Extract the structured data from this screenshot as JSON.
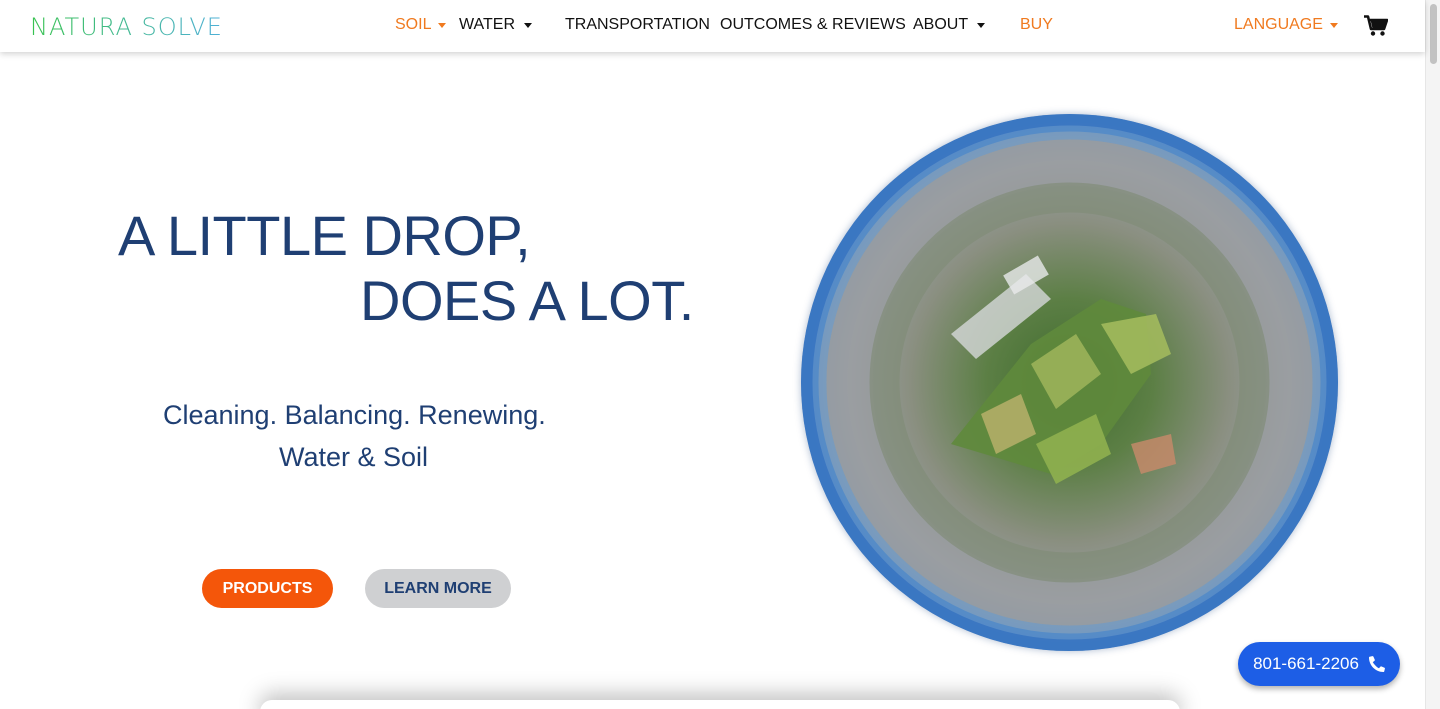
{
  "brand": {
    "logo_text": "NATURA SOLVE"
  },
  "nav": {
    "soil": "SOIL",
    "water": "WATER",
    "transportation": "TRANSPORTATION",
    "outcomes": "OUTCOMES & REVIEWS",
    "about": "ABOUT",
    "buy": "BUY",
    "language": "LANGUAGE",
    "cart_icon": "shopping-cart-icon"
  },
  "hero": {
    "headline_line1": "A LITTLE DROP,",
    "headline_line2": "DOES A LOT.",
    "sub_line1": "Cleaning. Balancing. Renewing.",
    "sub_line2": "Water & Soil",
    "products_button": "PRODUCTS",
    "learn_more_button": "LEARN MORE"
  },
  "contact": {
    "phone": "801-661-2206",
    "phone_icon": "phone-icon"
  },
  "colors": {
    "accent_orange": "#f07a1f",
    "products_button": "#f4560a",
    "headline_blue": "#1f3f73",
    "phone_button": "#1d5ee6",
    "learn_more_button": "#cfd0d2"
  }
}
